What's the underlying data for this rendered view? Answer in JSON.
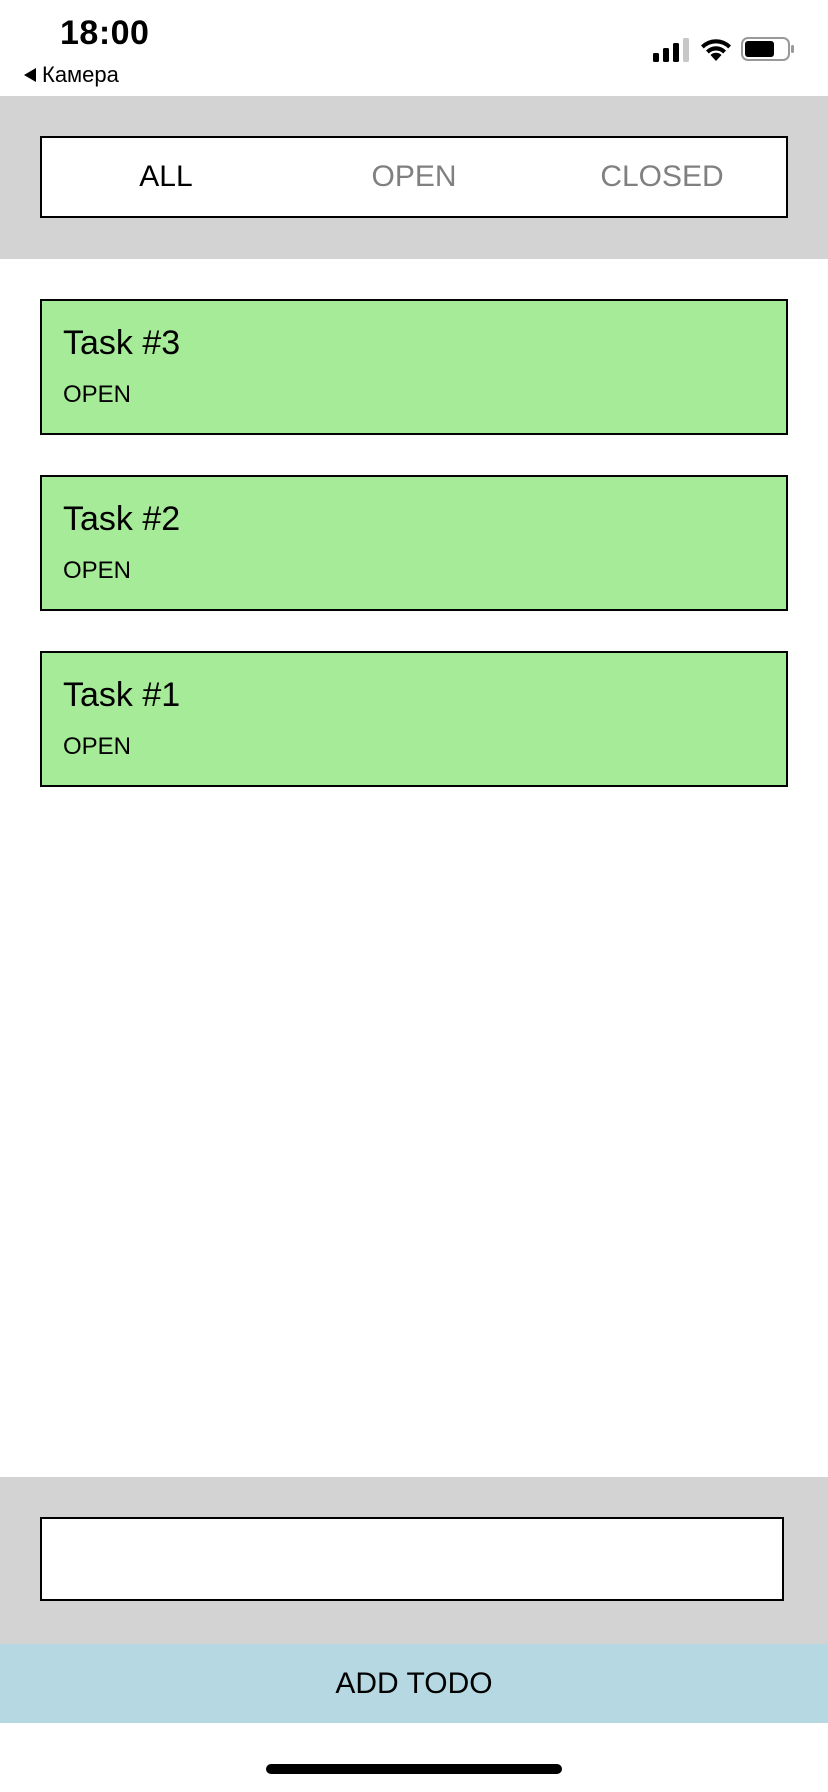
{
  "status_bar": {
    "time": "18:00",
    "back_label": "Камера"
  },
  "filters": {
    "tabs": [
      {
        "label": "ALL",
        "active": true
      },
      {
        "label": "OPEN",
        "active": false
      },
      {
        "label": "CLOSED",
        "active": false
      }
    ]
  },
  "tasks": [
    {
      "title": "Task #3",
      "status": "OPEN"
    },
    {
      "title": "Task #2",
      "status": "OPEN"
    },
    {
      "title": "Task #1",
      "status": "OPEN"
    }
  ],
  "add_todo": {
    "input_value": "",
    "button_label": "ADD TODO"
  },
  "colors": {
    "panel_gray": "#d3d3d3",
    "task_green": "#a6eb98",
    "button_blue": "#b5d8e3",
    "inactive_tab": "#808080"
  }
}
